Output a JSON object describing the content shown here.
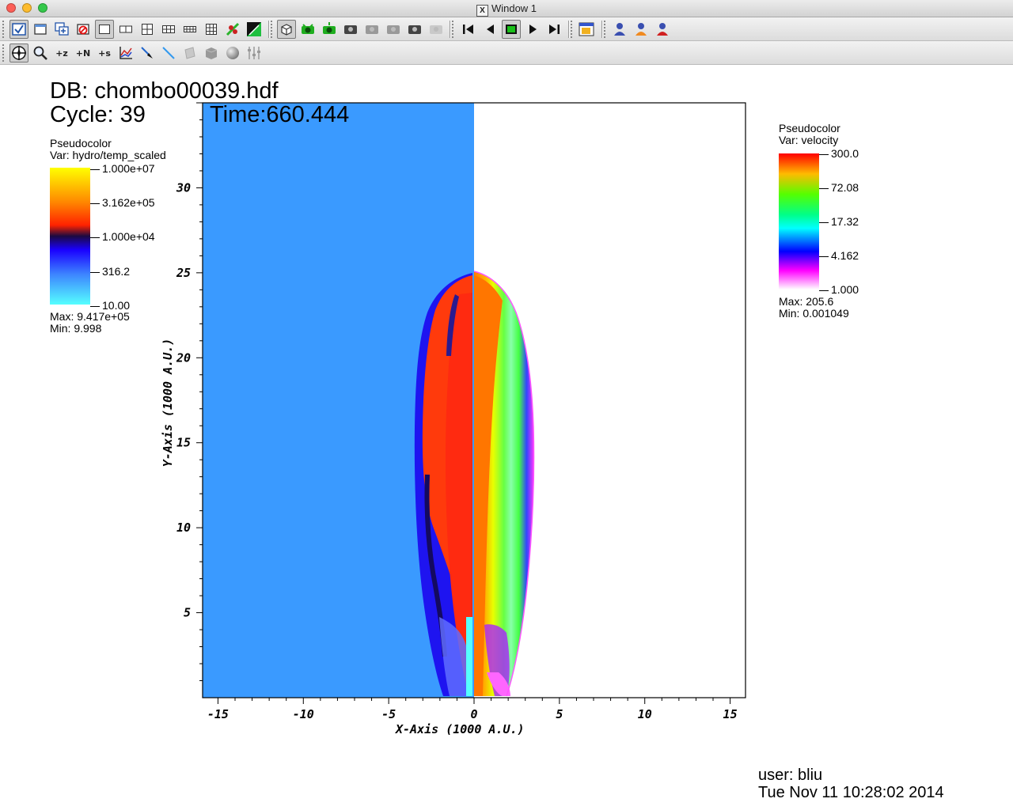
{
  "window": {
    "title": "Window 1",
    "x_badge": "X"
  },
  "toolbar1": {
    "buttons": [
      "active-window-toggle",
      "new-window",
      "clone-window",
      "delete-window",
      "layout-1x1",
      "layout-1x2",
      "layout-2x2",
      "layout-2x3",
      "layout-2x4",
      "layout-3x3",
      "lock-view",
      "lock-time",
      "navigate-mode-3d",
      "camera-green-1",
      "camera-green-2",
      "camera-dark",
      "camera-grey-1",
      "camera-grey-2",
      "camera-dark-2",
      "camera-disabled",
      "first-frame",
      "prev-frame",
      "stop",
      "play",
      "next-frame",
      "open-gui",
      "user-1",
      "user-2",
      "user-3"
    ]
  },
  "toolbar2": {
    "buttons": [
      "navigate",
      "zoom",
      "zone-pick",
      "node-pick",
      "spreadsheet-pick",
      "curve-pick",
      "line-out",
      "probe",
      "box",
      "plane",
      "sphere",
      "axis-sliders"
    ],
    "labels": {
      "zone": "+z",
      "node": "+N",
      "spreadsheet": "+s"
    }
  },
  "viewer": {
    "db_title": "DB: chombo00039.hdf",
    "cycle": "Cycle: 39",
    "time": "Time:660.444",
    "user": "user: bliu",
    "date": "Tue Nov 11 10:28:02 2014"
  },
  "legend_left": {
    "plot_type": "Pseudocolor",
    "var": "Var: hydro/temp_scaled",
    "ticks": [
      "1.000e+07",
      "3.162e+05",
      "1.000e+04",
      "316.2",
      "10.00"
    ],
    "max": "Max:  9.417e+05",
    "min": "Min:  9.998",
    "colors": [
      "#ffff00",
      "#ff7a00",
      "#ff2000",
      "#1a0a3a",
      "#1a00ff",
      "#3d85ff",
      "#55ffff"
    ]
  },
  "legend_right": {
    "plot_type": "Pseudocolor",
    "var": "Var: velocity",
    "ticks": [
      "300.0",
      "72.08",
      "17.32",
      "4.162",
      "1.000"
    ],
    "max": "Max:  205.6",
    "min": "Min:  0.001049",
    "colors": [
      "#ff0000",
      "#ffcc00",
      "#00ff00",
      "#00ffff",
      "#0000ff",
      "#ff00ff",
      "#ffffff"
    ]
  },
  "axes": {
    "x_title": "X-Axis (1000 A.U.)",
    "y_title": "Y-Axis (1000 A.U.)",
    "x_ticks": [
      "-15",
      "-10",
      "-5",
      "0",
      "5",
      "10",
      "15"
    ],
    "y_ticks": [
      "5",
      "10",
      "15",
      "20",
      "25",
      "30"
    ],
    "x_range": [
      -15.9,
      15.9
    ],
    "y_range": [
      0,
      35
    ]
  },
  "colors": {
    "background_left": "#3a9aff",
    "background_right": "#ffffff"
  }
}
